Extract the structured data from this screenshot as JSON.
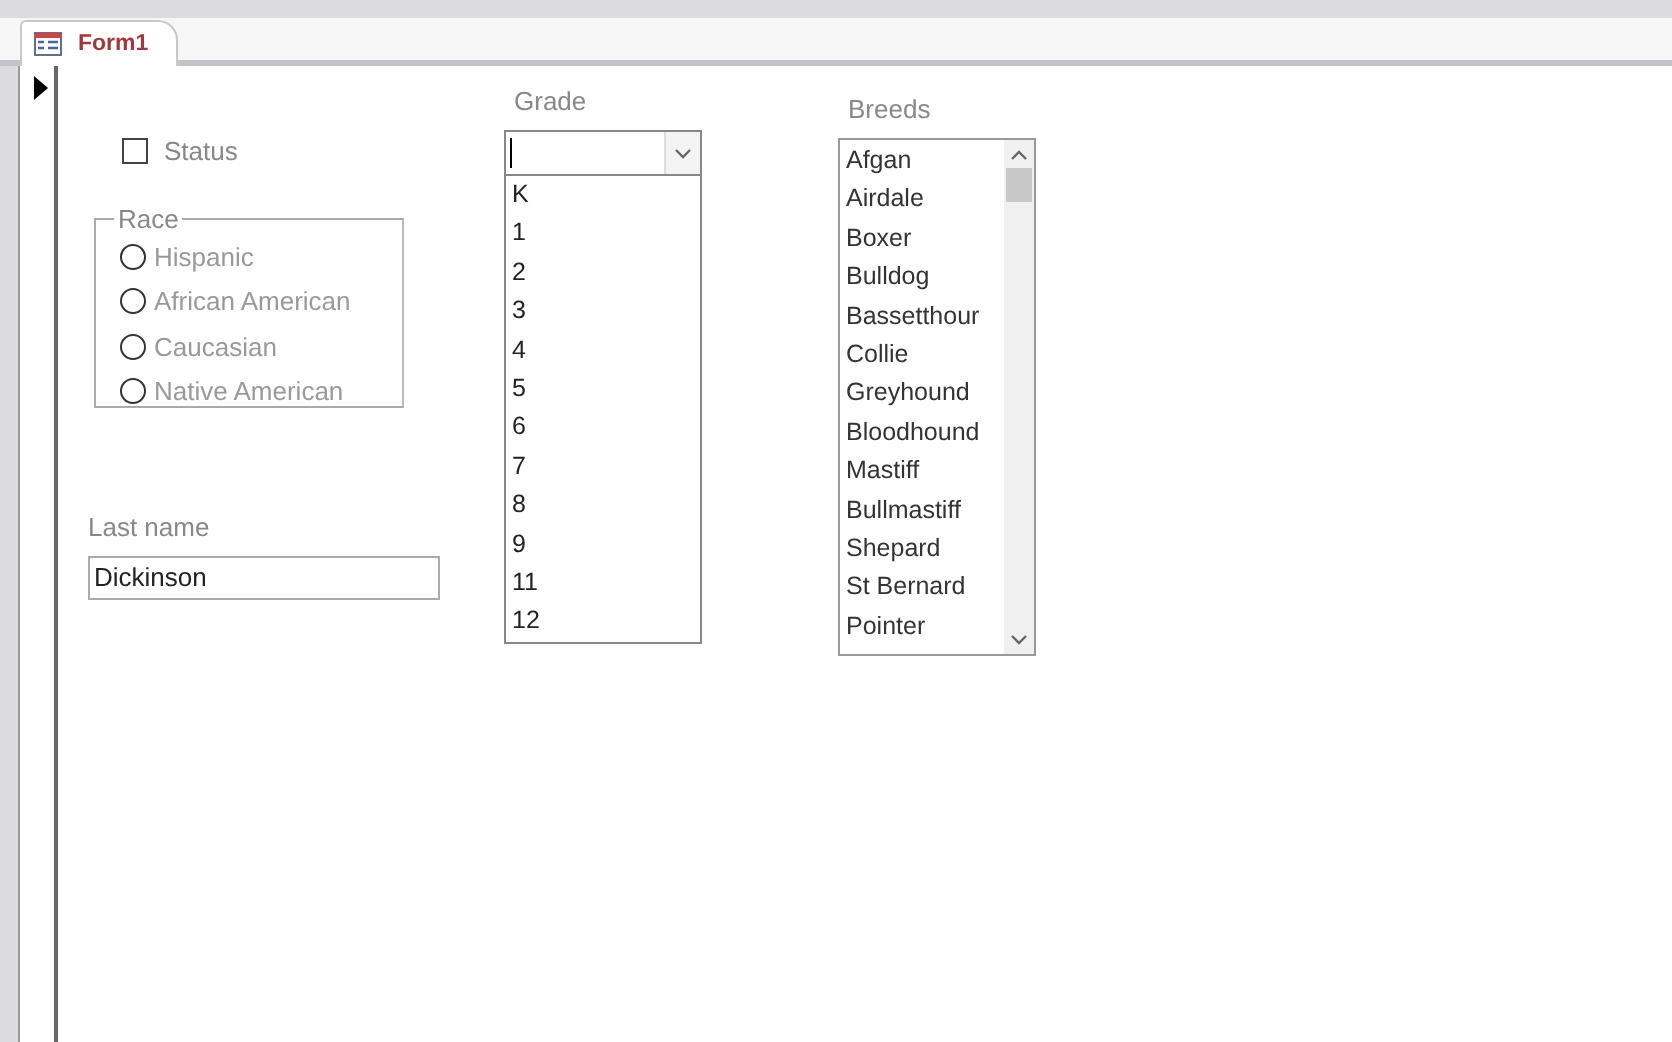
{
  "tab": {
    "title": "Form1",
    "selected": true
  },
  "status": {
    "label": "Status",
    "checked": false
  },
  "race": {
    "label": "Race",
    "options": [
      {
        "label": "Hispanic",
        "selected": false
      },
      {
        "label": "African American",
        "selected": false
      },
      {
        "label": "Caucasian",
        "selected": false
      },
      {
        "label": "Native American",
        "selected": false
      }
    ]
  },
  "last_name": {
    "label": "Last name",
    "value": "Dickinson"
  },
  "grade": {
    "label": "Grade",
    "expanded": true,
    "options": [
      "K",
      "1",
      "2",
      "3",
      "4",
      "5",
      "6",
      "7",
      "8",
      "9",
      "11",
      "12"
    ]
  },
  "breeds": {
    "label": "Breeds",
    "items": [
      {
        "label": "Afgan",
        "selected": false
      },
      {
        "label": "Airdale",
        "selected": false
      },
      {
        "label": "Boxer",
        "selected": false
      },
      {
        "label": "Bulldog",
        "selected": false
      },
      {
        "label": "Bassetthour",
        "selected": false
      },
      {
        "label": "Collie",
        "selected": false
      },
      {
        "label": "Greyhound",
        "selected": false
      },
      {
        "label": "Bloodhound",
        "selected": false
      },
      {
        "label": "Mastiff",
        "selected": false
      },
      {
        "label": "Bullmastiff",
        "selected": false
      },
      {
        "label": "Shepard",
        "selected": false
      },
      {
        "label": "St Bernard",
        "selected": false
      },
      {
        "label": "Pointer",
        "selected": false
      }
    ]
  }
}
